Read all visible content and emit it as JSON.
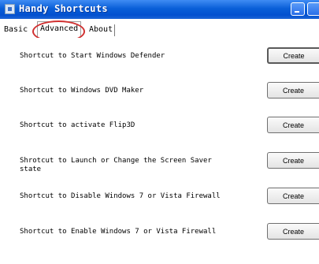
{
  "window": {
    "title": "Handy Shortcuts"
  },
  "tabs": [
    {
      "label": "Basic"
    },
    {
      "label": "Advanced"
    },
    {
      "label": "About"
    }
  ],
  "rows": [
    {
      "label": "Shortcut to Start Windows Defender",
      "button": "Create"
    },
    {
      "label": "Shortcut to Windows DVD Maker",
      "button": "Create"
    },
    {
      "label": "Shortcut to activate Flip3D",
      "button": "Create"
    },
    {
      "label": "Shrotcut to Launch or Change the Screen Saver\nstate",
      "button": "Create"
    },
    {
      "label": "Shortcut to Disable Windows 7 or Vista Firewall",
      "button": "Create"
    },
    {
      "label": "Shortcut to Enable Windows 7 or Vista Firewall",
      "button": "Create"
    }
  ],
  "colors": {
    "titlebar": "#0a5fd8",
    "highlight": "#d03030"
  }
}
